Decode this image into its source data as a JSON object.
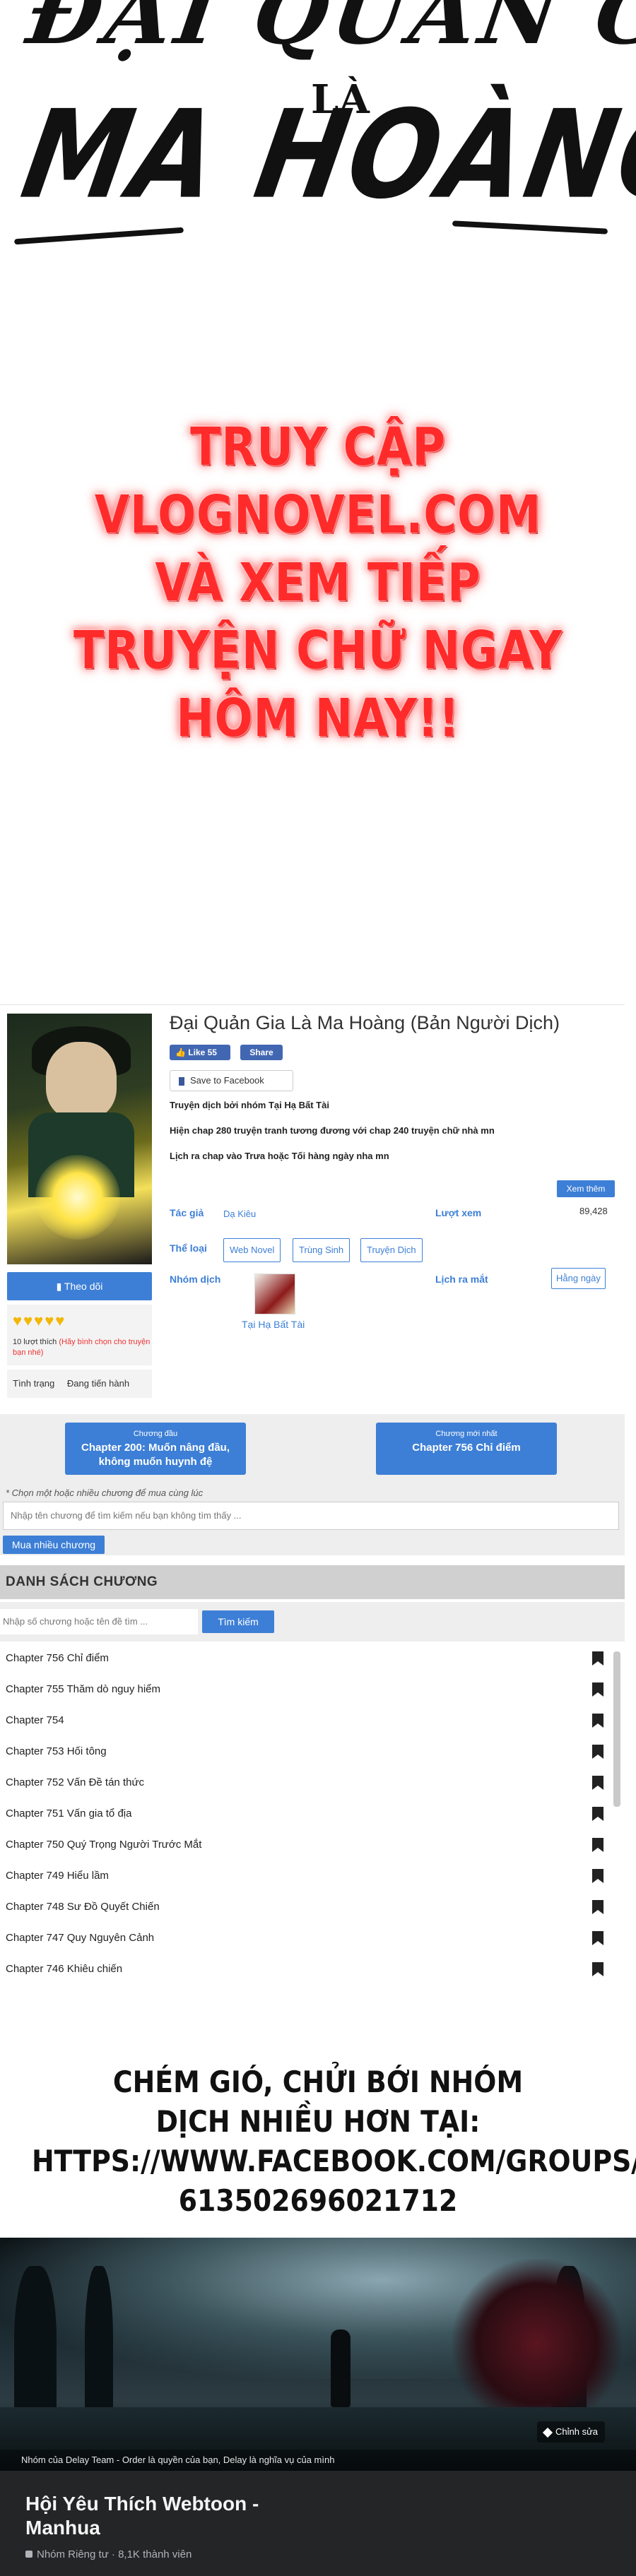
{
  "art": {
    "title_line1": "ĐẠI QUẢN GIA",
    "title_line2": "LÀ",
    "title_line3": "MA HOÀNG"
  },
  "promo": {
    "lines": [
      "TRUY CẬP",
      "VLOGNOVEL.COM",
      "VÀ XEM TIẾP",
      "TRUYỆN CHỮ NGAY",
      "HÔM NAY!!"
    ]
  },
  "manga": {
    "title": "Đại Quản Gia Là Ma Hoàng (Bản Người Dịch)",
    "fb_like_label": "Like 55",
    "fb_share_label": "Share",
    "save_fb_label": "Save to Facebook",
    "desc_group": "Truyện dịch bởi nhóm Tại Hạ Bất Tài",
    "desc_progress": "Hiện chap 280 truyện tranh tương đương với chap 240 truyện chữ nhà mn",
    "desc_schedule": "Lịch ra chap vào Trưa hoặc Tối hàng ngày nha mn",
    "more_label": "Xem thêm",
    "author_label": "Tác giả",
    "author_value": "Dạ Kiêu",
    "views_label": "Lượt xem",
    "views_value": "89,428",
    "genre_label": "Thể loại",
    "genres": [
      "Web Novel",
      "Trùng Sinh",
      "Truyện Dịch"
    ],
    "translator_label": "Nhóm dịch",
    "translator_name": "Tại Hạ Bất Tài",
    "schedule_label": "Lịch ra mắt",
    "schedule_value": "Hằng ngày",
    "follow_label": "Theo dõi",
    "hearts": "♥♥♥♥♥",
    "likes_text": "10 lượt thích",
    "likes_hint": "(Hãy bình chọn cho truyện bạn nhé)",
    "status_label": "Tình trạng",
    "status_value": "Đang tiến hành"
  },
  "chapter_nav": {
    "first_small": "Chương đầu",
    "first_big": "Chapter 200: Muốn nâng đầu, không muốn huynh đệ",
    "latest_small": "Chương mới nhất",
    "latest_big": "Chapter 756 Chỉ điểm",
    "note": "* Chọn một hoặc nhiều chương để mua cùng lúc",
    "input_placeholder": "Nhập tên chương để tìm kiếm nếu bạn không tìm thấy ...",
    "buy_label": "Mua nhiều chương"
  },
  "chapter_list": {
    "heading": "DANH SÁCH CHƯƠNG",
    "search_placeholder": "Nhập số chương hoặc tên đề tìm ...",
    "search_button": "Tìm kiếm",
    "chapters": [
      "Chapter 756 Chỉ điểm",
      "Chapter 755 Thăm dò nguy hiểm",
      "Chapter 754",
      "Chapter 753 Hối tông",
      "Chapter 752 Vấn Đề tán thức",
      "Chapter 751 Vấn gia tổ địa",
      "Chapter 750 Quý Trọng Người Trước Mắt",
      "Chapter 749 Hiểu lầm",
      "Chapter 748 Sư Đồ Quyết Chiến",
      "Chapter 747 Quy Nguyên Cảnh",
      "Chapter 746 Khiêu chiến"
    ]
  },
  "group_msg": {
    "lines": [
      "CHÉM GIÓ, CHỬI BỚI NHÓM",
      "DỊCH NHIỀU HƠN TẠI:",
      "HTTPS://WWW.FACEBOOK.COM/GROUPS/",
      "613502696021712"
    ]
  },
  "fb_group": {
    "change_photo": "Chỉnh sửa",
    "caption": "Nhóm của Delay Team - Order là quyền của bạn, Delay là nghĩa vụ của mình",
    "name": "Hội Yêu Thích Webtoon - Manhua",
    "meta": "Nhóm Riêng tư · 8,1K thành viên"
  }
}
